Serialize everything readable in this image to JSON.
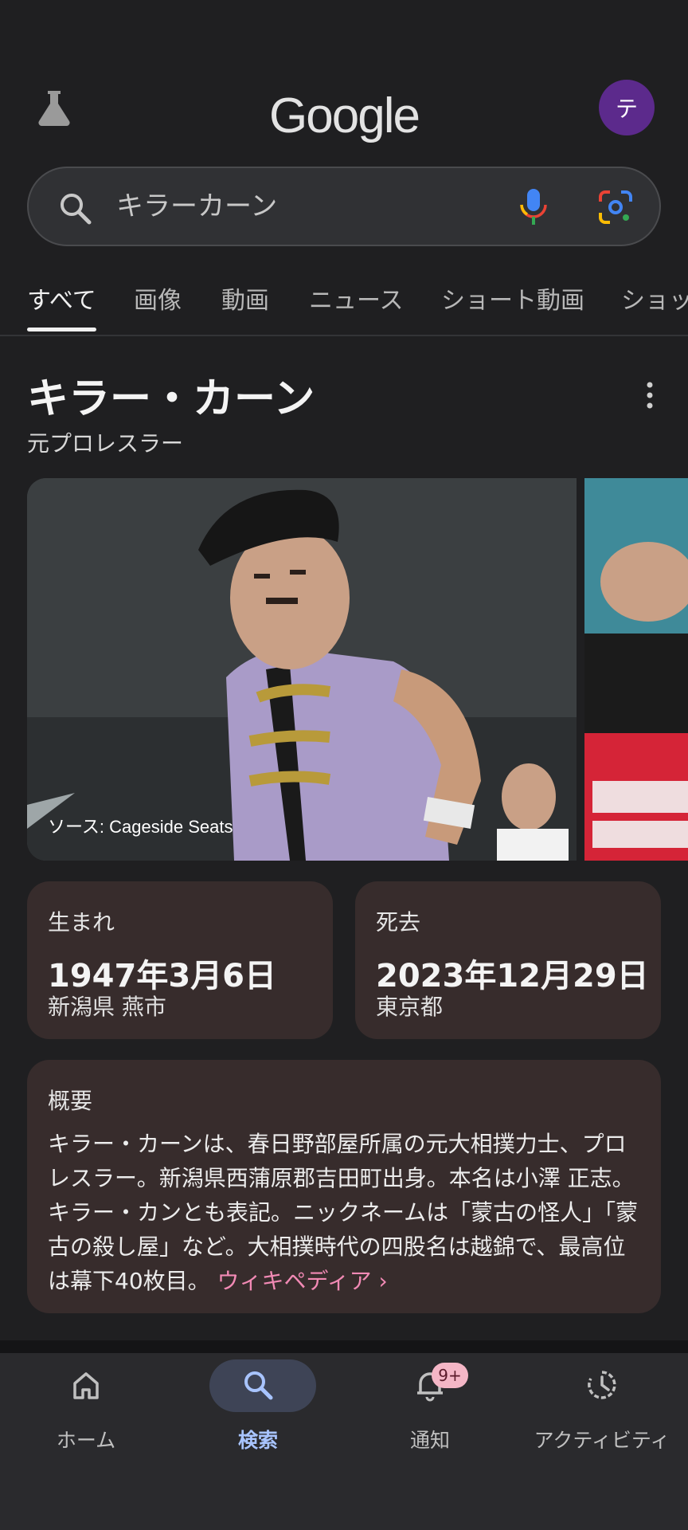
{
  "header": {
    "logo": "Google",
    "avatar_letter": "テ"
  },
  "search": {
    "query": "キラーカーン"
  },
  "tabs": [
    {
      "label": "すべて",
      "active": true
    },
    {
      "label": "画像"
    },
    {
      "label": "動画"
    },
    {
      "label": "ニュース"
    },
    {
      "label": "ショート動画"
    },
    {
      "label": "ショッ"
    }
  ],
  "entity": {
    "title": "キラー・カーン",
    "subtitle": "元プロレスラー",
    "photo_source": "ソース: Cageside Seats"
  },
  "facts": {
    "born": {
      "label": "生まれ",
      "date": "1947年3月6日",
      "place": "新潟県 燕市"
    },
    "died": {
      "label": "死去",
      "date": "2023年12月29日",
      "place": "東京都"
    }
  },
  "overview": {
    "label": "概要",
    "text": "キラー・カーンは、春日野部屋所属の元大相撲力士、プロレスラー。新潟県西蒲原郡吉田町出身。本名は小澤 正志。キラー・カンとも表記。ニックネームは「蒙古の怪人」「蒙古の殺し屋」など。大相撲時代の四股名は越錦で、最高位は幕下40枚目。",
    "link": "ウィキペディア ›"
  },
  "bottom_nav": {
    "home": "ホーム",
    "search": "検索",
    "notifications": "通知",
    "notifications_badge": "9+",
    "activity": "アクティビティ"
  },
  "colors": {
    "background": "#1f1f21",
    "card": "#372c2c",
    "link": "#f28ab5",
    "active_nav": "#a8c4ff",
    "avatar": "#5c2a8c"
  }
}
